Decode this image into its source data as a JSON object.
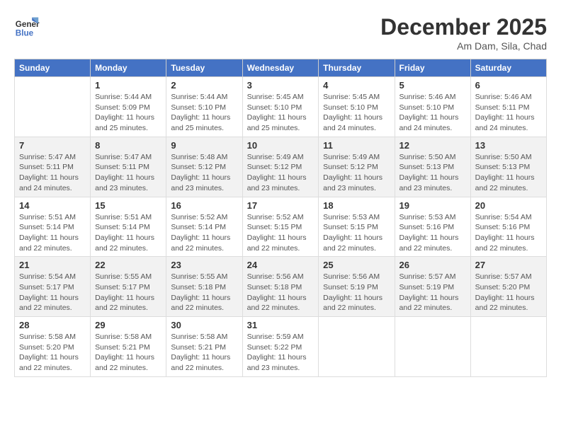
{
  "header": {
    "logo_line1": "General",
    "logo_line2": "Blue",
    "month": "December 2025",
    "location": "Am Dam, Sila, Chad"
  },
  "weekdays": [
    "Sunday",
    "Monday",
    "Tuesday",
    "Wednesday",
    "Thursday",
    "Friday",
    "Saturday"
  ],
  "weeks": [
    [
      {
        "day": "",
        "sunrise": "",
        "sunset": "",
        "daylight": ""
      },
      {
        "day": "1",
        "sunrise": "Sunrise: 5:44 AM",
        "sunset": "Sunset: 5:09 PM",
        "daylight": "Daylight: 11 hours and 25 minutes."
      },
      {
        "day": "2",
        "sunrise": "Sunrise: 5:44 AM",
        "sunset": "Sunset: 5:10 PM",
        "daylight": "Daylight: 11 hours and 25 minutes."
      },
      {
        "day": "3",
        "sunrise": "Sunrise: 5:45 AM",
        "sunset": "Sunset: 5:10 PM",
        "daylight": "Daylight: 11 hours and 25 minutes."
      },
      {
        "day": "4",
        "sunrise": "Sunrise: 5:45 AM",
        "sunset": "Sunset: 5:10 PM",
        "daylight": "Daylight: 11 hours and 24 minutes."
      },
      {
        "day": "5",
        "sunrise": "Sunrise: 5:46 AM",
        "sunset": "Sunset: 5:10 PM",
        "daylight": "Daylight: 11 hours and 24 minutes."
      },
      {
        "day": "6",
        "sunrise": "Sunrise: 5:46 AM",
        "sunset": "Sunset: 5:11 PM",
        "daylight": "Daylight: 11 hours and 24 minutes."
      }
    ],
    [
      {
        "day": "7",
        "sunrise": "Sunrise: 5:47 AM",
        "sunset": "Sunset: 5:11 PM",
        "daylight": "Daylight: 11 hours and 24 minutes."
      },
      {
        "day": "8",
        "sunrise": "Sunrise: 5:47 AM",
        "sunset": "Sunset: 5:11 PM",
        "daylight": "Daylight: 11 hours and 23 minutes."
      },
      {
        "day": "9",
        "sunrise": "Sunrise: 5:48 AM",
        "sunset": "Sunset: 5:12 PM",
        "daylight": "Daylight: 11 hours and 23 minutes."
      },
      {
        "day": "10",
        "sunrise": "Sunrise: 5:49 AM",
        "sunset": "Sunset: 5:12 PM",
        "daylight": "Daylight: 11 hours and 23 minutes."
      },
      {
        "day": "11",
        "sunrise": "Sunrise: 5:49 AM",
        "sunset": "Sunset: 5:12 PM",
        "daylight": "Daylight: 11 hours and 23 minutes."
      },
      {
        "day": "12",
        "sunrise": "Sunrise: 5:50 AM",
        "sunset": "Sunset: 5:13 PM",
        "daylight": "Daylight: 11 hours and 23 minutes."
      },
      {
        "day": "13",
        "sunrise": "Sunrise: 5:50 AM",
        "sunset": "Sunset: 5:13 PM",
        "daylight": "Daylight: 11 hours and 22 minutes."
      }
    ],
    [
      {
        "day": "14",
        "sunrise": "Sunrise: 5:51 AM",
        "sunset": "Sunset: 5:14 PM",
        "daylight": "Daylight: 11 hours and 22 minutes."
      },
      {
        "day": "15",
        "sunrise": "Sunrise: 5:51 AM",
        "sunset": "Sunset: 5:14 PM",
        "daylight": "Daylight: 11 hours and 22 minutes."
      },
      {
        "day": "16",
        "sunrise": "Sunrise: 5:52 AM",
        "sunset": "Sunset: 5:14 PM",
        "daylight": "Daylight: 11 hours and 22 minutes."
      },
      {
        "day": "17",
        "sunrise": "Sunrise: 5:52 AM",
        "sunset": "Sunset: 5:15 PM",
        "daylight": "Daylight: 11 hours and 22 minutes."
      },
      {
        "day": "18",
        "sunrise": "Sunrise: 5:53 AM",
        "sunset": "Sunset: 5:15 PM",
        "daylight": "Daylight: 11 hours and 22 minutes."
      },
      {
        "day": "19",
        "sunrise": "Sunrise: 5:53 AM",
        "sunset": "Sunset: 5:16 PM",
        "daylight": "Daylight: 11 hours and 22 minutes."
      },
      {
        "day": "20",
        "sunrise": "Sunrise: 5:54 AM",
        "sunset": "Sunset: 5:16 PM",
        "daylight": "Daylight: 11 hours and 22 minutes."
      }
    ],
    [
      {
        "day": "21",
        "sunrise": "Sunrise: 5:54 AM",
        "sunset": "Sunset: 5:17 PM",
        "daylight": "Daylight: 11 hours and 22 minutes."
      },
      {
        "day": "22",
        "sunrise": "Sunrise: 5:55 AM",
        "sunset": "Sunset: 5:17 PM",
        "daylight": "Daylight: 11 hours and 22 minutes."
      },
      {
        "day": "23",
        "sunrise": "Sunrise: 5:55 AM",
        "sunset": "Sunset: 5:18 PM",
        "daylight": "Daylight: 11 hours and 22 minutes."
      },
      {
        "day": "24",
        "sunrise": "Sunrise: 5:56 AM",
        "sunset": "Sunset: 5:18 PM",
        "daylight": "Daylight: 11 hours and 22 minutes."
      },
      {
        "day": "25",
        "sunrise": "Sunrise: 5:56 AM",
        "sunset": "Sunset: 5:19 PM",
        "daylight": "Daylight: 11 hours and 22 minutes."
      },
      {
        "day": "26",
        "sunrise": "Sunrise: 5:57 AM",
        "sunset": "Sunset: 5:19 PM",
        "daylight": "Daylight: 11 hours and 22 minutes."
      },
      {
        "day": "27",
        "sunrise": "Sunrise: 5:57 AM",
        "sunset": "Sunset: 5:20 PM",
        "daylight": "Daylight: 11 hours and 22 minutes."
      }
    ],
    [
      {
        "day": "28",
        "sunrise": "Sunrise: 5:58 AM",
        "sunset": "Sunset: 5:20 PM",
        "daylight": "Daylight: 11 hours and 22 minutes."
      },
      {
        "day": "29",
        "sunrise": "Sunrise: 5:58 AM",
        "sunset": "Sunset: 5:21 PM",
        "daylight": "Daylight: 11 hours and 22 minutes."
      },
      {
        "day": "30",
        "sunrise": "Sunrise: 5:58 AM",
        "sunset": "Sunset: 5:21 PM",
        "daylight": "Daylight: 11 hours and 22 minutes."
      },
      {
        "day": "31",
        "sunrise": "Sunrise: 5:59 AM",
        "sunset": "Sunset: 5:22 PM",
        "daylight": "Daylight: 11 hours and 23 minutes."
      },
      {
        "day": "",
        "sunrise": "",
        "sunset": "",
        "daylight": ""
      },
      {
        "day": "",
        "sunrise": "",
        "sunset": "",
        "daylight": ""
      },
      {
        "day": "",
        "sunrise": "",
        "sunset": "",
        "daylight": ""
      }
    ]
  ]
}
